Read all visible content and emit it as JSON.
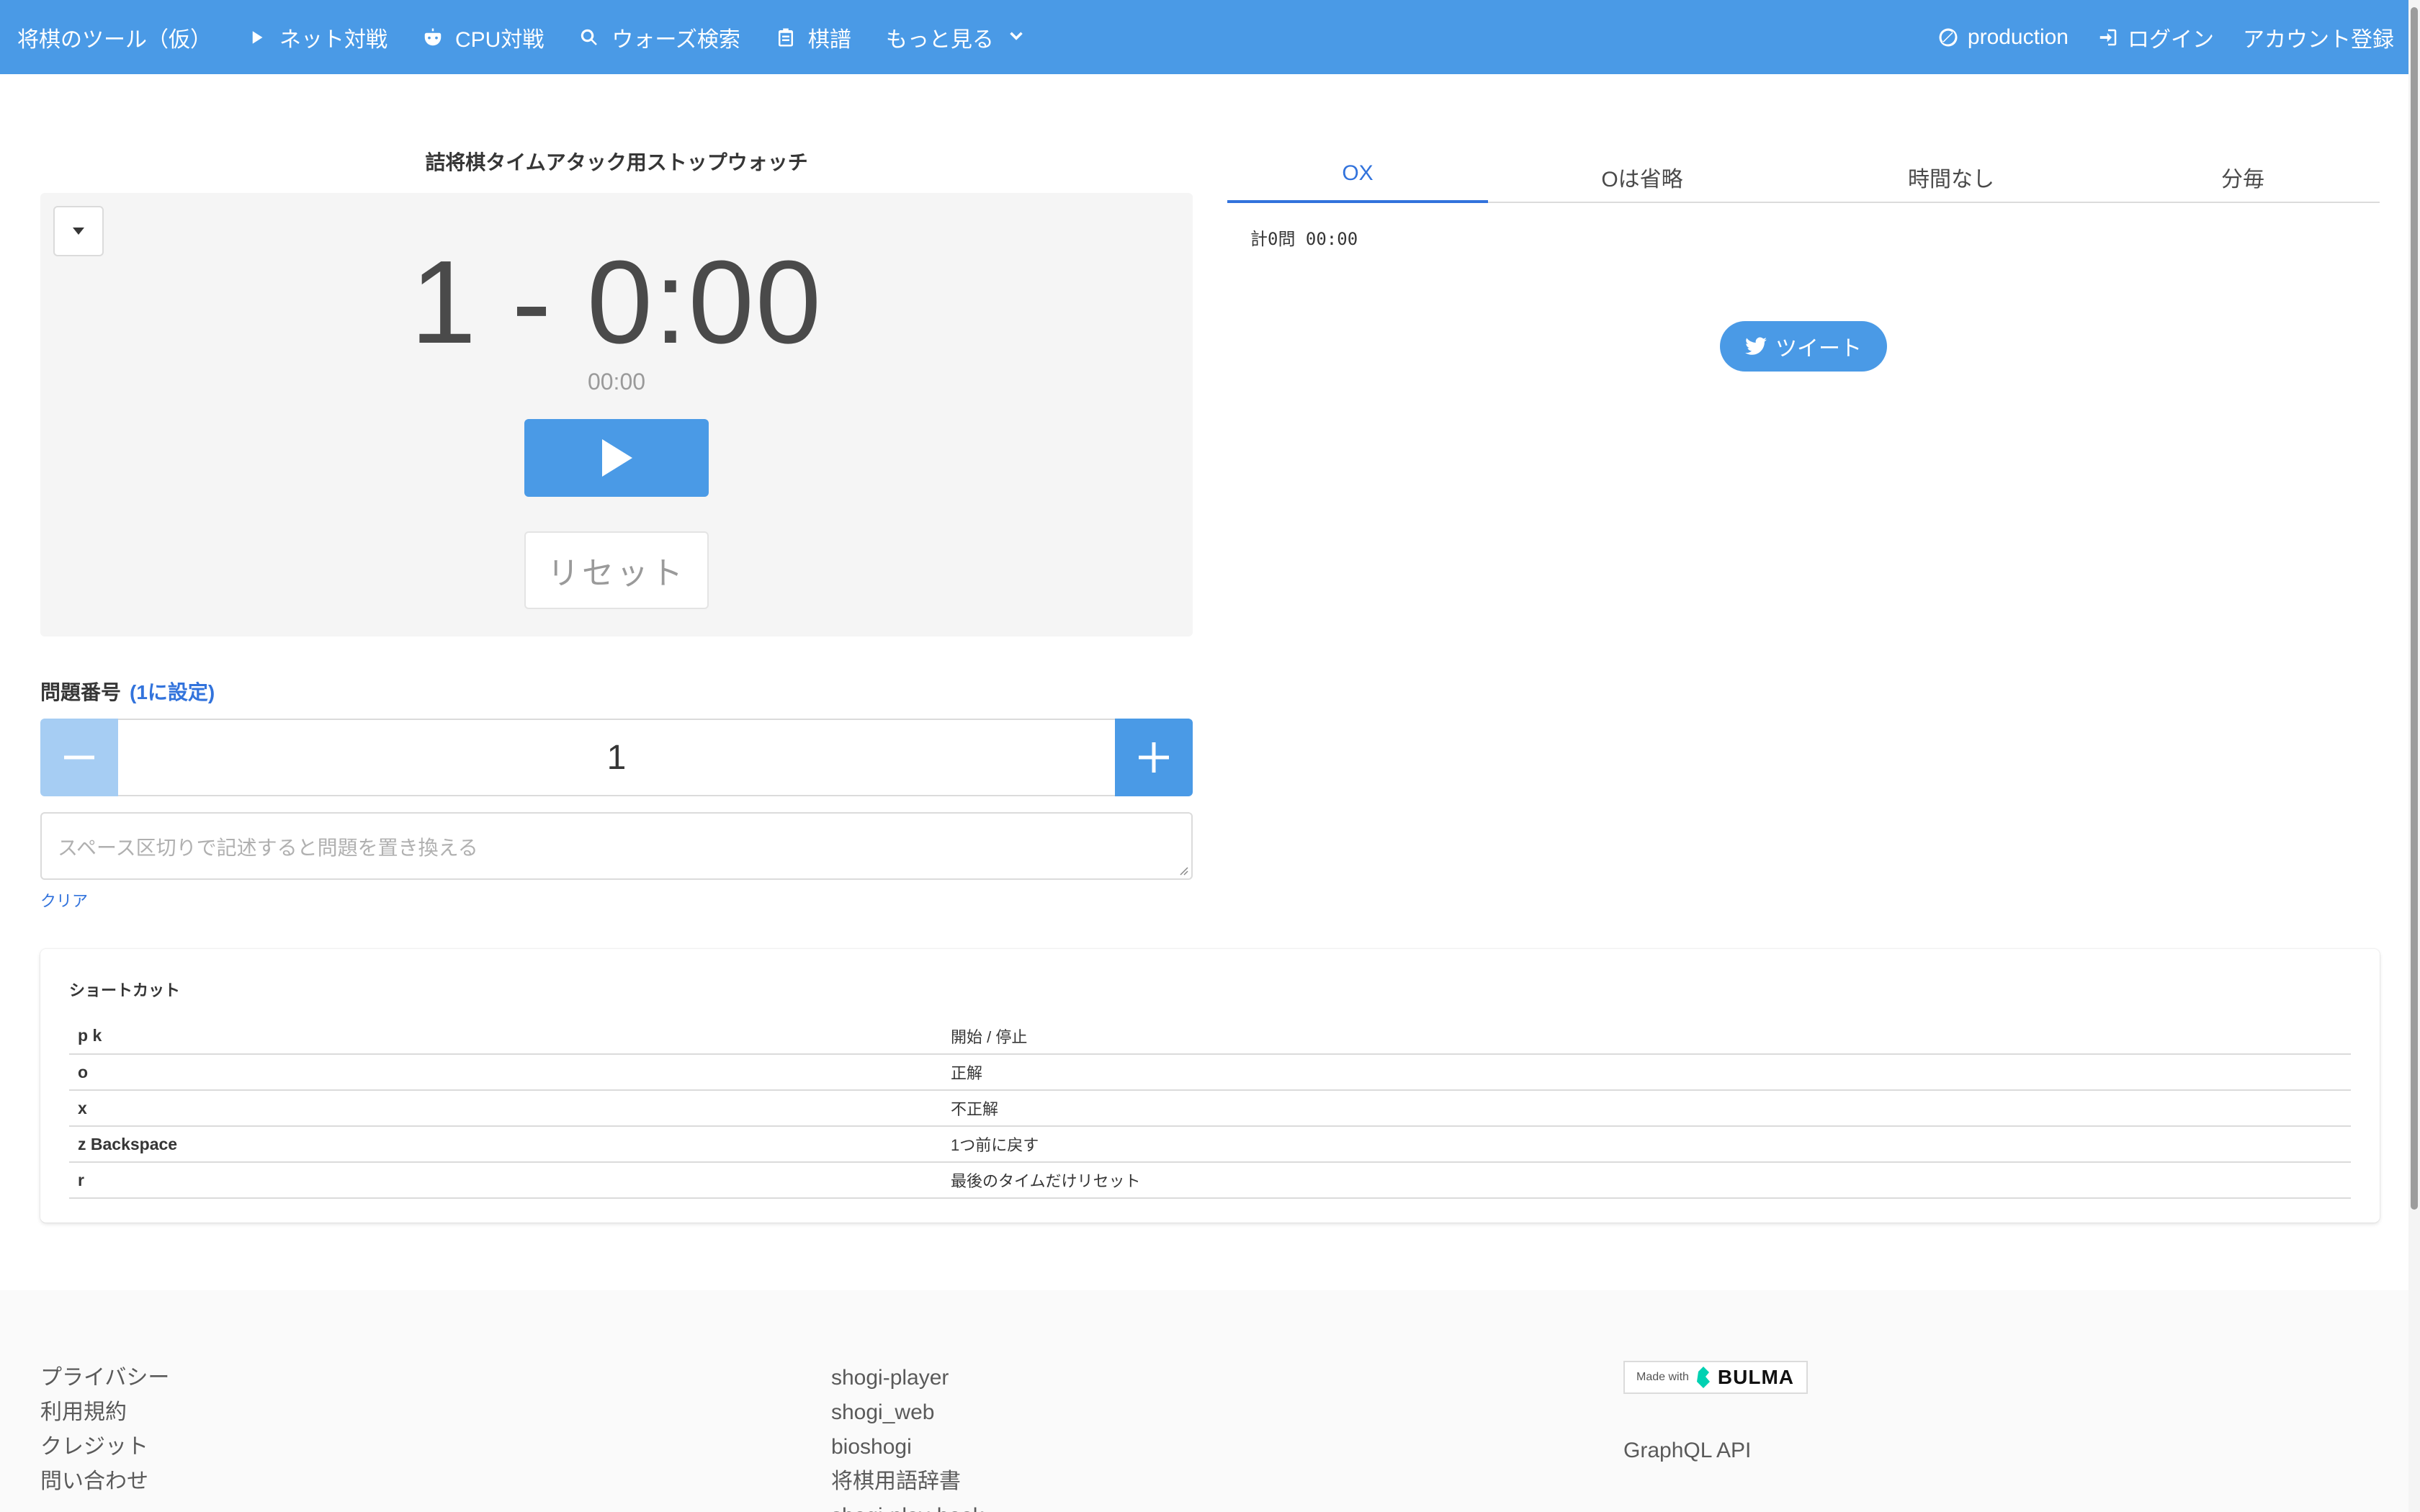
{
  "navbar": {
    "brand": "将棋のツール（仮）",
    "items": [
      {
        "label": "ネット対戦",
        "icon": "play-icon"
      },
      {
        "label": "CPU対戦",
        "icon": "robot-icon"
      },
      {
        "label": "ウォーズ検索",
        "icon": "search-icon"
      },
      {
        "label": "棋譜",
        "icon": "clipboard-icon"
      },
      {
        "label": "もっと見る",
        "icon": "chevron-down-icon"
      }
    ],
    "right": [
      {
        "label": "production",
        "icon": "cancel-circle-icon"
      },
      {
        "label": "ログイン",
        "icon": "login-icon"
      },
      {
        "label": "アカウント登録"
      }
    ]
  },
  "stopwatch": {
    "title": "詰将棋タイムアタック用ストップウォッチ",
    "main_display": "1 - 0:00",
    "sub_display": "00:00",
    "reset_label": "リセット"
  },
  "question": {
    "label": "問題番号",
    "set_link": "(1に設定)",
    "value": "1",
    "replace_placeholder": "スペース区切りで記述すると問題を置き換える",
    "clear_link": "クリア"
  },
  "tabs": [
    "OX",
    "Oは省略",
    "時間なし",
    "分毎"
  ],
  "active_tab": "OX",
  "summary": "計0問 00:00",
  "tweet_label": "ツイート",
  "shortcuts": {
    "title": "ショートカット",
    "rows": [
      {
        "key": "p k",
        "action": "開始 / 停止"
      },
      {
        "key": "o",
        "action": "正解"
      },
      {
        "key": "x",
        "action": "不正解"
      },
      {
        "key": "z Backspace",
        "action": "1つ前に戻す"
      },
      {
        "key": "r",
        "action": "最後のタイムだけリセット"
      }
    ]
  },
  "footer": {
    "col1": [
      "プライバシー",
      "利用規約",
      "クレジット",
      "問い合わせ"
    ],
    "col2": [
      "shogi-player",
      "shogi_web",
      "bioshogi",
      "将棋用語辞書",
      "shogi-play-book"
    ],
    "badge_made": "Made with",
    "badge_logo": "BULMA",
    "graphql": "GraphQL API"
  },
  "colors": {
    "primary": "#4a9ae6",
    "link": "#3273dc"
  }
}
